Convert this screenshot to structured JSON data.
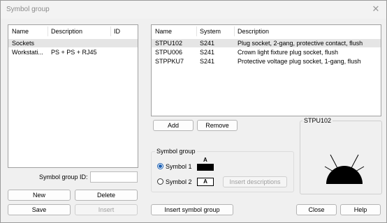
{
  "window": {
    "title": "Symbol group",
    "close_glyph": "✕"
  },
  "left_list": {
    "headers": [
      "Name",
      "Description",
      "ID"
    ],
    "rows": [
      {
        "name": "Sockets",
        "description": "",
        "id": "",
        "selected": true
      },
      {
        "name": "Workstati...",
        "description": "PS + PS + RJ45",
        "id": "",
        "selected": false
      }
    ]
  },
  "right_list": {
    "headers": [
      "Name",
      "System",
      "Description"
    ],
    "rows": [
      {
        "name": "STPU102",
        "system": "S241",
        "description": "Plug socket, 2-gang, protective contact, flush",
        "selected": true
      },
      {
        "name": "STPU006",
        "system": "S241",
        "description": "Crown light fixture plug socket, flush",
        "selected": false
      },
      {
        "name": "STPPKU7",
        "system": "S241",
        "description": "Protective voltage plug socket, 1-gang, flush",
        "selected": false
      }
    ]
  },
  "symbol_group_id": {
    "label": "Symbol group ID:",
    "value": ""
  },
  "buttons": {
    "new": "New",
    "delete": "Delete",
    "save": "Save",
    "insert": "Insert",
    "add": "Add",
    "remove": "Remove",
    "insert_symbol_group": "Insert symbol group",
    "insert_descriptions": "Insert descriptions",
    "close": "Close",
    "help": "Help"
  },
  "symbol_group": {
    "title": "Symbol group",
    "symbol1_label": "Symbol 1",
    "symbol2_label": "Symbol 2",
    "swatch_letter": "A",
    "selected": "Symbol 1"
  },
  "preview": {
    "title": "STPU102",
    "icon": "socket-symbol-icon"
  },
  "colors": {
    "selection": "#e5e5e5",
    "radio_accent": "#1a5fb4"
  }
}
